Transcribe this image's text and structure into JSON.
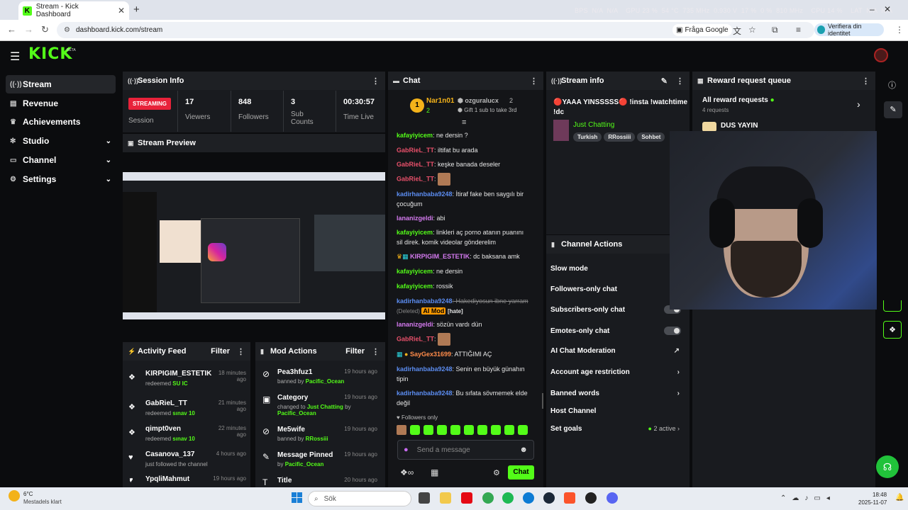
{
  "browser": {
    "tab_title": "Stream - Kick Dashboard",
    "url": "dashboard.kick.com/stream",
    "fraga_google": "Fråga Google",
    "verify_label": "Verifiera din identitet",
    "system_stats": "BPS  N/A  N/A    GPU 23 %  54 °C  735 MHz  0.930 V  17 %  0 %  810 MHz    CPU 14 %    LAT  N/A  N/A"
  },
  "app": {
    "logo": "KICK",
    "beta": "BETA"
  },
  "sidebar": {
    "items": [
      {
        "label": "Stream",
        "icon": "broadcast-icon"
      },
      {
        "label": "Revenue",
        "icon": "wallet-icon"
      },
      {
        "label": "Achievements",
        "icon": "trophy-icon"
      },
      {
        "label": "Studio",
        "icon": "gear-icon"
      },
      {
        "label": "Channel",
        "icon": "gear-icon"
      },
      {
        "label": "Settings",
        "icon": "gear-icon"
      }
    ]
  },
  "session": {
    "title": "Session Info",
    "status": "STREAMING",
    "status_label": "Session",
    "stats": [
      {
        "value": "17",
        "label": "Viewers"
      },
      {
        "value": "848",
        "label": "Followers"
      },
      {
        "value": "3",
        "label": "Sub Counts"
      },
      {
        "value": "00:30:57",
        "label": "Time Live"
      }
    ]
  },
  "preview": {
    "title": "Stream Preview"
  },
  "activity": {
    "title": "Activity Feed",
    "filter": "Filter",
    "items": [
      {
        "name": "KIRPIGIM_ESTETIK",
        "text": "redeemed",
        "highlight": "SU IC",
        "time": "18 minutes ago"
      },
      {
        "name": "GabRieL_TT",
        "text": "redeemed",
        "highlight": "sınav 10",
        "time": "21 minutes ago"
      },
      {
        "name": "qimpt0ven",
        "text": "redeemed",
        "highlight": "sınav 10",
        "time": "22 minutes ago"
      },
      {
        "name": "Casanova_137",
        "text": "just followed the channel",
        "highlight": "",
        "time": "4 hours ago"
      },
      {
        "name": "YpqliMahmut",
        "text": "",
        "highlight": "",
        "time": "19 hours ago"
      }
    ]
  },
  "mod": {
    "title": "Mod Actions",
    "filter": "Filter",
    "items": [
      {
        "name": "Pea3hfuz1",
        "text": "banned by",
        "highlight": "Pacific_Ocean",
        "time": "19 hours ago"
      },
      {
        "name": "Category",
        "text": "changed to",
        "highlight": "Just Chatting",
        "extra": "by",
        "extra2": "Pacific_Ocean",
        "time": "19 hours ago"
      },
      {
        "name": "Me5wife",
        "text": "banned by",
        "highlight": "RRossiii",
        "time": "19 hours ago"
      },
      {
        "name": "Message Pinned",
        "text": "by",
        "highlight": "Pacific_Ocean",
        "time": "19 hours ago"
      },
      {
        "name": "Title",
        "text": "",
        "highlight": "",
        "time": "20 hours ago"
      }
    ]
  },
  "chat": {
    "title": "Chat",
    "top_user1": "Nar1n01",
    "top_user1_count": "2",
    "top_user2": "ozguralucx",
    "top_user2_count": "2",
    "gift_text": "Gift 1 sub to take 3rd",
    "messages": [
      {
        "user": "kafayiyicem",
        "color": "g",
        "text": ": ne dersin ?"
      },
      {
        "user": "GabRieL_TT",
        "color": "r",
        "text": ": iltifat bu arada"
      },
      {
        "user": "GabRieL_TT",
        "color": "r",
        "text": ": keşke banada deseler"
      },
      {
        "user": "GabRieL_TT",
        "color": "r",
        "text": ":"
      },
      {
        "user": "kadirhanbaba9248",
        "color": "b",
        "text": ": İtiraf fake ben saygılı bir çocuğum"
      },
      {
        "user": "lananizgeldi",
        "color": "p",
        "text": ": abi"
      },
      {
        "user": "kafayiyicem",
        "color": "g",
        "text": ": linkleri aç porno atanın puanını sil direk. komik videolar gönderelim"
      },
      {
        "user": "KIRPIGIM_ESTETIK",
        "color": "p",
        "text": ": dc baksana amk"
      },
      {
        "user": "kafayiyicem",
        "color": "g",
        "text": ": ne dersin"
      },
      {
        "user": "kafayiyicem",
        "color": "g",
        "text": ": rossik"
      },
      {
        "user": "kadirhanbaba9248",
        "color": "b",
        "text": ": Hakediyosun ibne yarram",
        "deleted": "(Deleted)",
        "aimod": "AI Mod",
        "hate": "[hate]"
      },
      {
        "user": "lananizgeldi",
        "color": "p",
        "text": ": sözün vardı dün"
      },
      {
        "user": "GabRieL_TT",
        "color": "r",
        "text": ":"
      },
      {
        "user": "SayGex31699",
        "color": "o",
        "text": ": ATTIĞIMI AÇ"
      },
      {
        "user": "kadirhanbaba9248",
        "color": "b",
        "text": ": Senin en büyük günahın tipin"
      },
      {
        "user": "kadirhanbaba9248",
        "color": "b",
        "text": ": Bu sıfata sövmemek elde değil"
      }
    ],
    "followers_only": "Followers only",
    "placeholder": "Send a message",
    "send": "Chat"
  },
  "stream_info": {
    "title": "Stream info",
    "stream_title": "🔴YAAA YINSSSSS🔴 !insta !watchtime !dc",
    "category": "Just Chatting",
    "tags": [
      "Turkish",
      "RRossiii",
      "Sohbet"
    ]
  },
  "reward": {
    "title": "Reward request queue",
    "all": "All reward requests",
    "count": "4 requests",
    "item": "DUS YAYIN"
  },
  "channel_actions": {
    "title": "Channel Actions",
    "items": [
      "Slow mode",
      "Followers-only chat",
      "Subscribers-only chat",
      "Emotes-only chat",
      "AI Chat Moderation",
      "Account age restriction",
      "Banned words",
      "Host Channel",
      "Set goals"
    ],
    "goals_status": "2 active"
  },
  "taskbar": {
    "weather_temp": "6°C",
    "weather_desc": "Mestadels klart",
    "search": "Sök",
    "time": "18:48",
    "date": "2025-11-07"
  },
  "colors": {
    "brand": "#53fc18",
    "streaming": "#e8223a"
  }
}
